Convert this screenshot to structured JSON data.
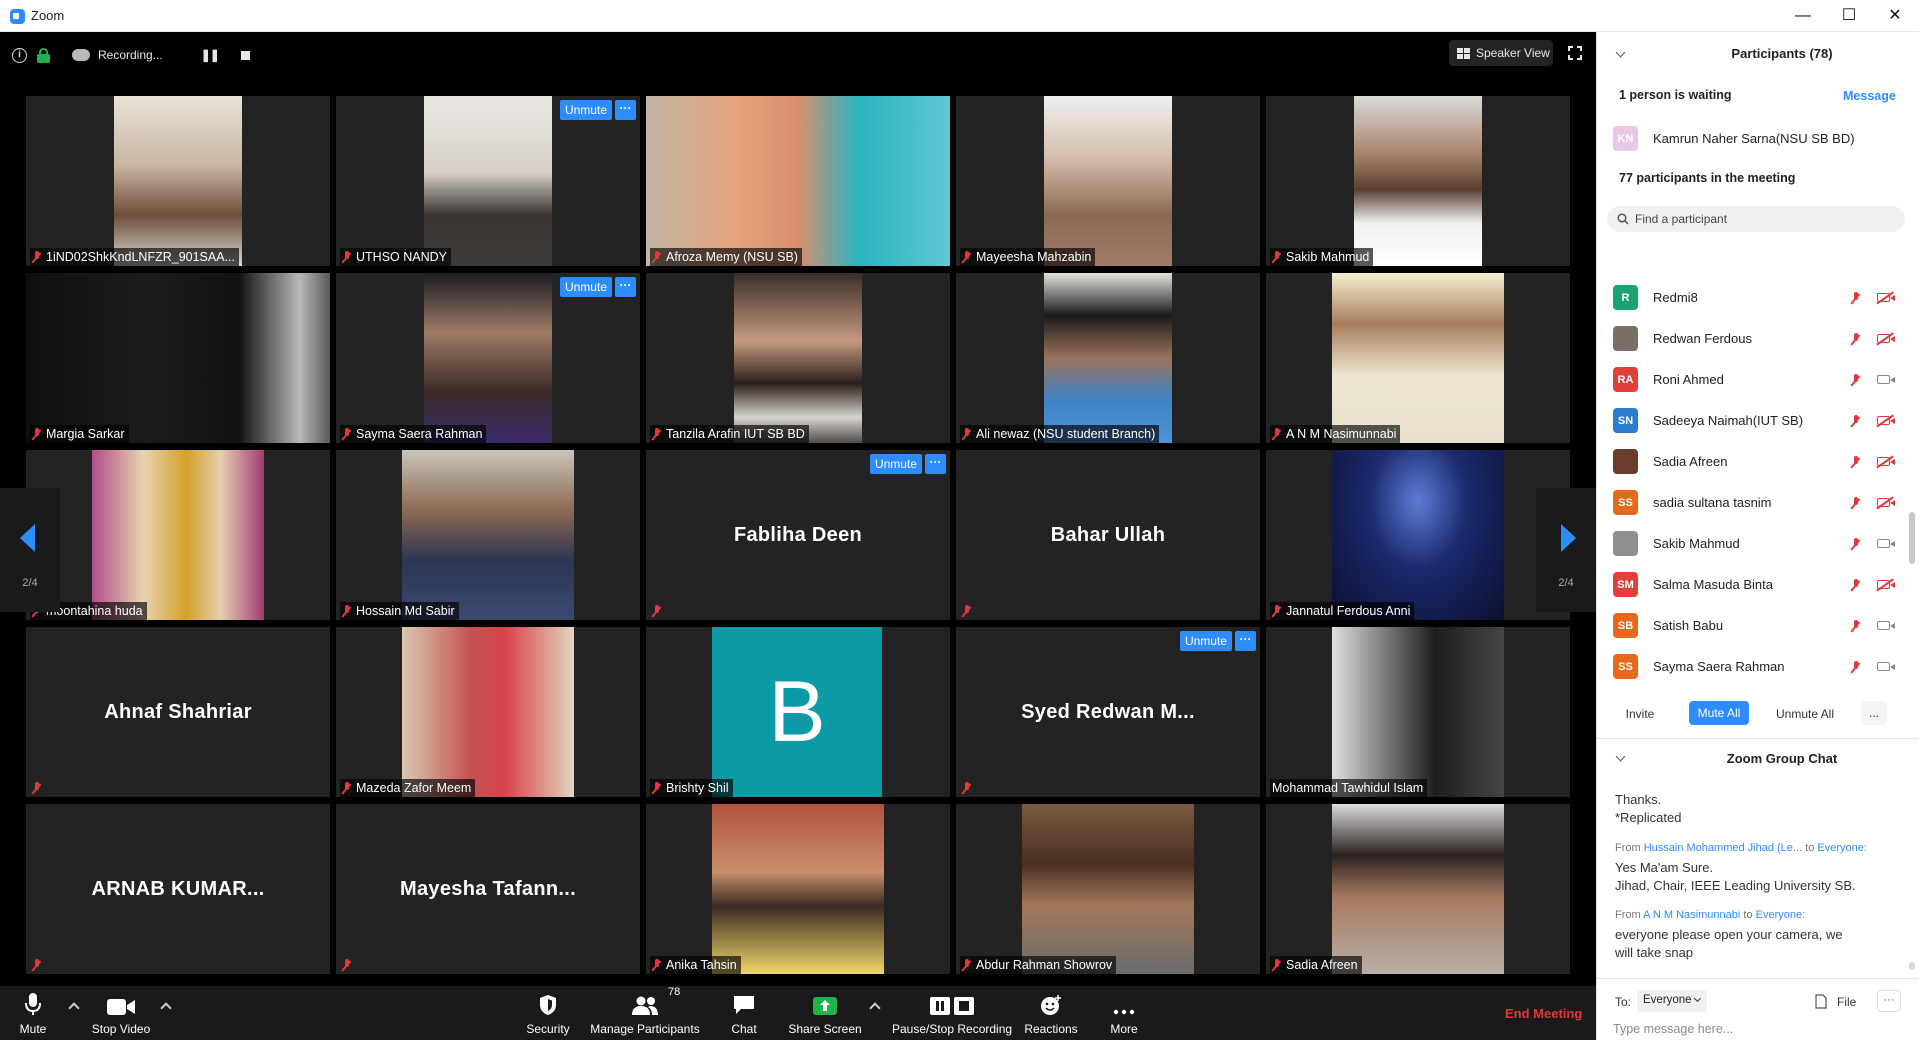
{
  "window": {
    "title": "Zoom",
    "minimize": "—",
    "maximize": "☐",
    "close": "✕"
  },
  "topbar": {
    "recording_text": "Recording...",
    "speaker_view_label": "Speaker View"
  },
  "grid": {
    "page_indicator_left": "2/4",
    "page_indicator_right": "2/4",
    "unmute_label": "Unmute",
    "more_label": "···",
    "tiles": [
      {
        "name": "1iND02ShkKndLNFZR_901SAA..."
      },
      {
        "name": "UTHSO NANDY"
      },
      {
        "name": "Afroza Memy (NSU SB)"
      },
      {
        "name": "Mayeesha Mahzabin"
      },
      {
        "name": "Sakib Mahmud"
      },
      {
        "name": "Margia Sarkar"
      },
      {
        "name": "Sayma Saera Rahman"
      },
      {
        "name": "Tanzila Arafin IUT SB BD"
      },
      {
        "name": "Ali newaz (NSU student Branch)"
      },
      {
        "name": "A N M Nasimunnabi"
      },
      {
        "name": "moontahina huda"
      },
      {
        "name": "Hossain Md Sabir"
      },
      {
        "display": "Fabliha Deen"
      },
      {
        "display": "Bahar Ullah"
      },
      {
        "name": "Jannatul Ferdous Anni"
      },
      {
        "display": "Ahnaf Shahriar"
      },
      {
        "name": "Mazeda Zafor Meem"
      },
      {
        "name": "Brishty Shil",
        "avatar_letter": "B"
      },
      {
        "display": "Syed Redwan M..."
      },
      {
        "name": "Mohammad Tawhidul Islam"
      },
      {
        "display": "ARNAB KUMAR..."
      },
      {
        "display": "Mayesha Tafann..."
      },
      {
        "name": "Anika Tahsin"
      },
      {
        "name": "Abdur Rahman Showrov"
      },
      {
        "name": "Sadia Afreen"
      }
    ]
  },
  "toolbar": {
    "mute": "Mute",
    "stop_video": "Stop Video",
    "security": "Security",
    "manage_participants": "Manage Participants",
    "participant_count": "78",
    "chat": "Chat",
    "share_screen": "Share Screen",
    "pause_stop_recording": "Pause/Stop Recording",
    "reactions": "Reactions",
    "more": "More",
    "end_meeting": "End Meeting"
  },
  "participants_panel": {
    "title": "Participants (78)",
    "waiting_text": "1 person is waiting",
    "message_link": "Message",
    "waiting_person": {
      "initials": "KN",
      "name": "Kamrun Naher Sarna(NSU SB BD)"
    },
    "in_meeting_text": "77 participants in the meeting",
    "search_placeholder": "Find a participant",
    "list": [
      {
        "initials": "R",
        "name": "Redmi8",
        "avatar_color": "#1aa36f",
        "video_off": true
      },
      {
        "initials": "",
        "name": "Redwan Ferdous",
        "avatar_color": "#7a6e66",
        "video_off": true
      },
      {
        "initials": "RA",
        "name": "Roni Ahmed",
        "avatar_color": "#e0403a",
        "video_off": false
      },
      {
        "initials": "SN",
        "name": "Sadeeya Naimah(IUT SB)",
        "avatar_color": "#2a7ccd",
        "video_off": true
      },
      {
        "initials": "",
        "name": "Sadia Afreen",
        "avatar_color": "#6b3b2e",
        "video_off": true
      },
      {
        "initials": "SS",
        "name": "sadia sultana tasnim",
        "avatar_color": "#e66a1a",
        "video_off": true
      },
      {
        "initials": "",
        "name": "Sakib Mahmud",
        "avatar_color": "#8e8e8e",
        "video_off": false
      },
      {
        "initials": "SM",
        "name": "Salma Masuda Binta",
        "avatar_color": "#e0403a",
        "video_off": true
      },
      {
        "initials": "SB",
        "name": "Satish Babu",
        "avatar_color": "#e66a1a",
        "video_off": false
      },
      {
        "initials": "SS",
        "name": "Sayma Saera Rahman",
        "avatar_color": "#e66a1a",
        "video_off": false
      }
    ],
    "invite": "Invite",
    "mute_all": "Mute All",
    "unmute_all": "Unmute All",
    "more": "..."
  },
  "chat_panel": {
    "title": "Zoom Group Chat",
    "line1": "Thanks.",
    "line2": "*Replicated",
    "msg1_from_prefix": "From",
    "msg1_sender": "Hussain Mohammed Jihad (Le...",
    "msg1_to_prefix": "to",
    "msg1_to": "Everyone:",
    "msg1_line1": "Yes Ma'am Sure.",
    "msg1_line2": "Jihad, Chair, IEEE Leading University SB.",
    "msg2_from_prefix": "From",
    "msg2_sender": "A N M Nasimunnabi",
    "msg2_to_prefix": "to",
    "msg2_to": "Everyone:",
    "msg2_line1": "everyone please open your camera, we",
    "msg2_line2": "will take snap",
    "to_label": "To:",
    "to_value": "Everyone",
    "file_label": "File",
    "more": "···",
    "input_placeholder": "Type message here..."
  }
}
